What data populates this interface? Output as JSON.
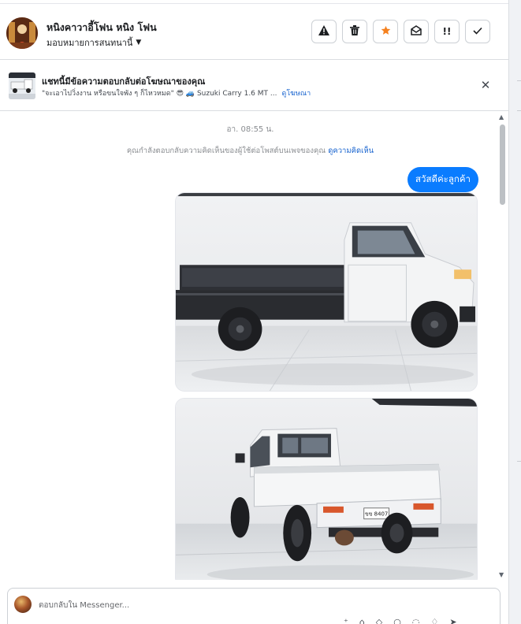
{
  "header": {
    "contact_name": "หนิงคาวาอี้โฟน หนิง โฟน",
    "assign_label": "มอบหมายการสนทนานี้",
    "assign_caret": "▼",
    "actions": [
      {
        "icon": "warning-icon",
        "glyph": "▲"
      },
      {
        "icon": "trash-icon",
        "glyph": "🗑"
      },
      {
        "icon": "star-icon",
        "glyph": "★"
      },
      {
        "icon": "mark-unread-icon",
        "glyph": "✉"
      },
      {
        "icon": "priority-icon",
        "glyph": "!!"
      },
      {
        "icon": "done-icon",
        "glyph": "✓"
      }
    ]
  },
  "ad_banner": {
    "title": "แชทนี้มีข้อความตอบกลับต่อโฆษณาของคุณ",
    "quote": "\"จะเอาไปวิ่งงาน หรือขนใจพัง ๆ ก็ไหวหมด\" 😎 🚙 Suzuki Carry 1.6 MT ...",
    "link": "ดูโฆษณา",
    "close_glyph": "✕"
  },
  "conversation": {
    "timestamp": "อา. 08:55 น.",
    "notice_text": "คุณกำลังตอบกลับความคิดเห็นของผู้ใช้ต่อโพสต์บนเพจของคุณ",
    "notice_link": "ดูความคิดเห็น",
    "outgoing_message": "สวัสดีค่ะลูกค้า",
    "photos": [
      {
        "subject": "white pickup truck side view"
      },
      {
        "subject": "white pickup truck rear three-quarter view",
        "plate": "ขข 8407"
      }
    ]
  },
  "composer": {
    "placeholder": "ตอบกลับใน Messenger..."
  },
  "colors": {
    "accent": "#0a7cff",
    "link": "#1763cf",
    "star": "#f5811f",
    "muted": "#8a8d91"
  }
}
